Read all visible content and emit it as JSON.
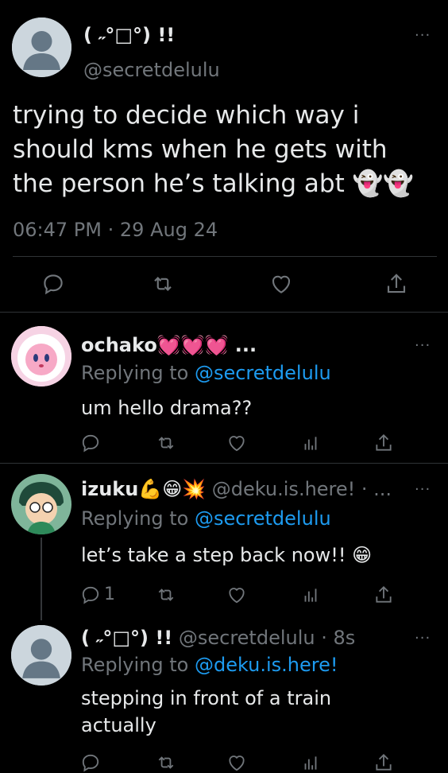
{
  "main_tweet": {
    "display_name": "( ˶°□°) !!",
    "handle": "@secretdelulu",
    "text": "trying to decide which way i should kms when he gets with the person he’s talking abt 👻👻",
    "time": "06:47 PM",
    "date": "29 Aug 24",
    "separator": "·"
  },
  "replies": [
    {
      "display_name": "ochako💓💓💓 ...",
      "replying_label": "Replying to",
      "replying_to": "@secretdelulu",
      "text": "um hello drama??",
      "reply_count": ""
    },
    {
      "display_name": "izuku💪😁💥",
      "handle": "@deku.is.here! · ...",
      "replying_label": "Replying to",
      "replying_to": "@secretdelulu",
      "text": "let’s take a step back now!! 😁",
      "reply_count": "1"
    },
    {
      "display_name": "( ˶°□°) !!",
      "handle": "@secretdelulu · 8s",
      "replying_label": "Replying to",
      "replying_to": "@deku.is.here!",
      "text": "stepping in front of a train actually"
    }
  ],
  "more_label": "···",
  "colors": {
    "background": "#000000",
    "text": "#e7e9ea",
    "muted": "#71767b",
    "link": "#1d9bf0",
    "divider": "#2f3336"
  },
  "icons": [
    "more-icon",
    "reply-icon",
    "retweet-icon",
    "like-icon",
    "share-icon",
    "analytics-icon"
  ]
}
